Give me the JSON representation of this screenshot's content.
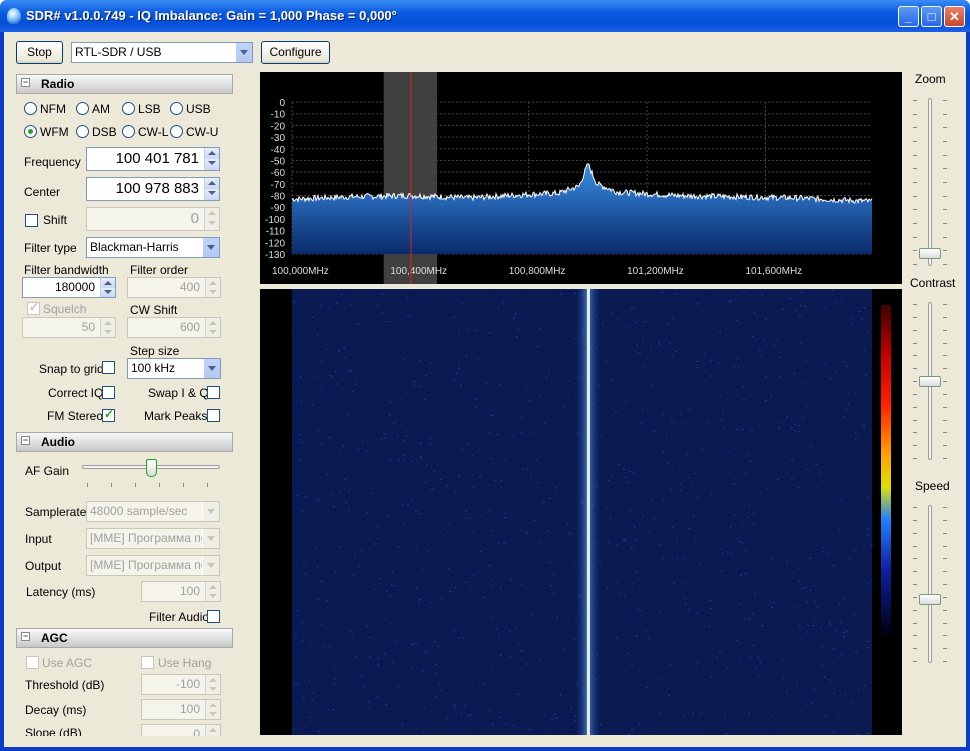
{
  "window": {
    "title": "SDR# v1.0.0.749 - IQ Imbalance: Gain = 1,000 Phase = 0,000°",
    "min": "_",
    "max": "□",
    "close": "✕"
  },
  "toolbar": {
    "stop": "Stop",
    "device": "RTL-SDR / USB",
    "configure": "Configure"
  },
  "radio": {
    "section": "Radio",
    "modes": [
      {
        "label": "NFM",
        "on": false
      },
      {
        "label": "AM",
        "on": false
      },
      {
        "label": "LSB",
        "on": false
      },
      {
        "label": "USB",
        "on": false
      },
      {
        "label": "WFM",
        "on": true
      },
      {
        "label": "DSB",
        "on": false
      },
      {
        "label": "CW-L",
        "on": false
      },
      {
        "label": "CW-U",
        "on": false
      }
    ],
    "frequency_label": "Frequency",
    "frequency": "100 401 781",
    "center_label": "Center",
    "center": "100 978 883",
    "shift_label": "Shift",
    "shift": "0",
    "filter_type_label": "Filter type",
    "filter_type": "Blackman-Harris",
    "filter_bw_label": "Filter bandwidth",
    "filter_bw": "180000",
    "filter_order_label": "Filter order",
    "filter_order": "400",
    "squelch_label": "Squelch",
    "squelch": "50",
    "cw_shift_label": "CW Shift",
    "cw_shift": "600",
    "step_size_label": "Step size",
    "step_size": "100 kHz",
    "snap_label": "Snap to grid",
    "correct_iq_label": "Correct IQ",
    "swap_label": "Swap I & Q",
    "fm_stereo_label": "FM Stereo",
    "mark_peaks_label": "Mark Peaks"
  },
  "audio": {
    "section": "Audio",
    "af_gain_label": "AF Gain",
    "af_gain_level": 0.5,
    "samplerate_label": "Samplerate",
    "samplerate": "48000 sample/sec",
    "input_label": "Input",
    "input": "[MME] Программа пер",
    "output_label": "Output",
    "output": "[MME] Программа пер",
    "latency_label": "Latency (ms)",
    "latency": "100",
    "filter_audio_label": "Filter Audio"
  },
  "agc": {
    "section": "AGC",
    "use_agc_label": "Use AGC",
    "use_hang_label": "Use Hang",
    "threshold_label": "Threshold (dB)",
    "threshold": "-100",
    "decay_label": "Decay (ms)",
    "decay": "100",
    "slope_label": "Slope (dB)",
    "slope": "0"
  },
  "right": {
    "zoom_label": "Zoom",
    "contrast_label": "Contrast",
    "speed_label": "Speed",
    "zoom_level": 0.05,
    "contrast_level": 0.5,
    "speed_level": 0.4
  },
  "chart_data": {
    "type": "line",
    "title": "",
    "xlabel": "",
    "ylabel": "",
    "y_ticks": [
      "0",
      "-10",
      "-20",
      "-30",
      "-40",
      "-50",
      "-60",
      "-70",
      "-80",
      "-90",
      "-100",
      "-110",
      "-120",
      "-130"
    ],
    "x_ticks": [
      "100,000MHz",
      "100,400MHz",
      "100,800MHz",
      "101,200MHz",
      "101,600MHz"
    ],
    "xlim": [
      100.0,
      101.96
    ],
    "ylim": [
      -130,
      0
    ],
    "noise_floor_db": -82,
    "peak": {
      "x": 101.0,
      "y": -53
    },
    "tuned_freq": 100.4018,
    "filter_band": [
      100.31,
      100.49
    ],
    "series": [
      {
        "x": [
          100.0,
          100.2,
          100.4,
          100.6,
          100.8,
          100.9,
          100.97,
          101.0,
          101.03,
          101.1,
          101.3,
          101.5,
          101.7,
          101.96
        ],
        "values": [
          -83,
          -81,
          -80,
          -82,
          -79,
          -78,
          -72,
          -53,
          -70,
          -77,
          -80,
          -81,
          -82,
          -85
        ]
      }
    ]
  }
}
